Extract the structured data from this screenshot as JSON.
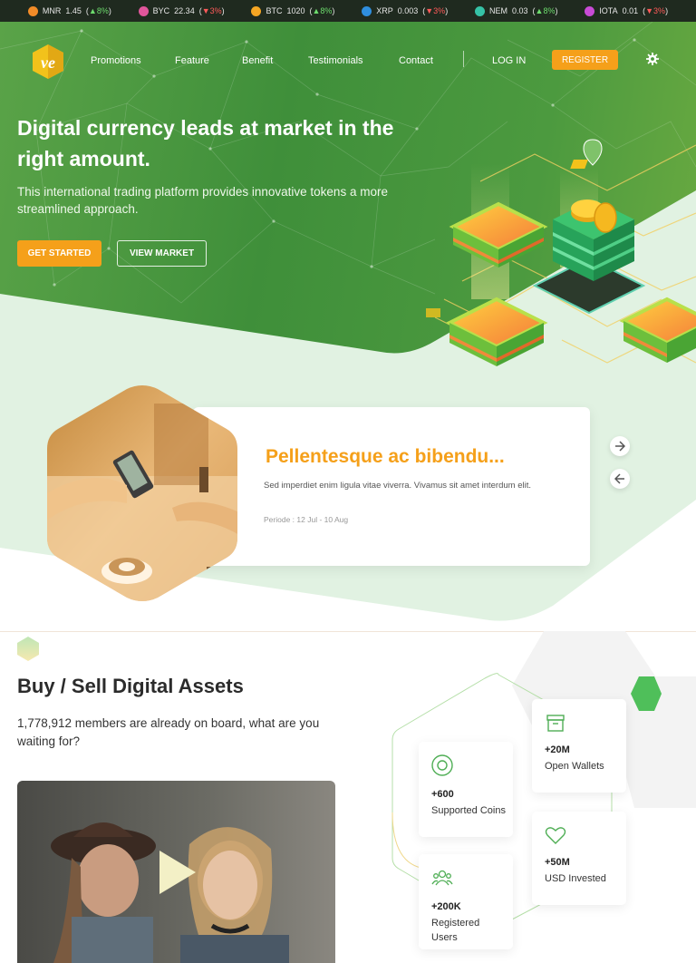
{
  "ticker": [
    {
      "symbol": "MNR",
      "price": "1.45",
      "change": "8%",
      "dir": "up",
      "color": "#f28c28",
      "icon": "mnr-coin-icon"
    },
    {
      "symbol": "BYC",
      "price": "22.34",
      "change": "3%",
      "dir": "down",
      "color": "#e0569b",
      "icon": "byc-coin-icon"
    },
    {
      "symbol": "BTC",
      "price": "1020",
      "change": "8%",
      "dir": "up",
      "color": "#f5a623",
      "icon": "btc-coin-icon"
    },
    {
      "symbol": "XRP",
      "price": "0.003",
      "change": "3%",
      "dir": "down",
      "color": "#2f8ede",
      "icon": "xrp-coin-icon"
    },
    {
      "symbol": "NEM",
      "price": "0.03",
      "change": "8%",
      "dir": "up",
      "color": "#35c2a6",
      "icon": "nem-coin-icon"
    },
    {
      "symbol": "IOTA",
      "price": "0.01",
      "change": "3%",
      "dir": "down",
      "color": "#c84bd6",
      "icon": "iota-coin-icon"
    }
  ],
  "nav": {
    "links": [
      "Promotions",
      "Feature",
      "Benefit",
      "Testimonials",
      "Contact"
    ],
    "login": "LOG IN",
    "register": "REGISTER"
  },
  "hero": {
    "title": "Digital currency leads at market in the right amount.",
    "subtitle": "This international trading platform provides innovative tokens a more streamlined approach.",
    "cta_primary": "GET STARTED",
    "cta_secondary": "VIEW MARKET"
  },
  "promo": {
    "title": "Pellentesque ac bibendu...",
    "description": "Sed imperdiet enim ligula vitae viverra. Vivamus sit amet interdum elit.",
    "period_label": "Periode :",
    "period_value": "12 Jul - 10 Aug"
  },
  "assets": {
    "title": "Buy / Sell Digital Assets",
    "subtitle": "1,778,912 members are already on board, what are you waiting for?",
    "stats": [
      {
        "value": "+600",
        "label": "Supported Coins",
        "icon": "coin-icon"
      },
      {
        "value": "+200K",
        "label": "Registered Users",
        "icon": "users-icon"
      },
      {
        "value": "+20M",
        "label": "Open Wallets",
        "icon": "wallet-box-icon"
      },
      {
        "value": "+50M",
        "label": "USD Invested",
        "icon": "heart-icon"
      }
    ]
  },
  "colors": {
    "accent": "#f5a01a",
    "brand_green": "#3f8f3a",
    "band": "#e1f2e2"
  }
}
